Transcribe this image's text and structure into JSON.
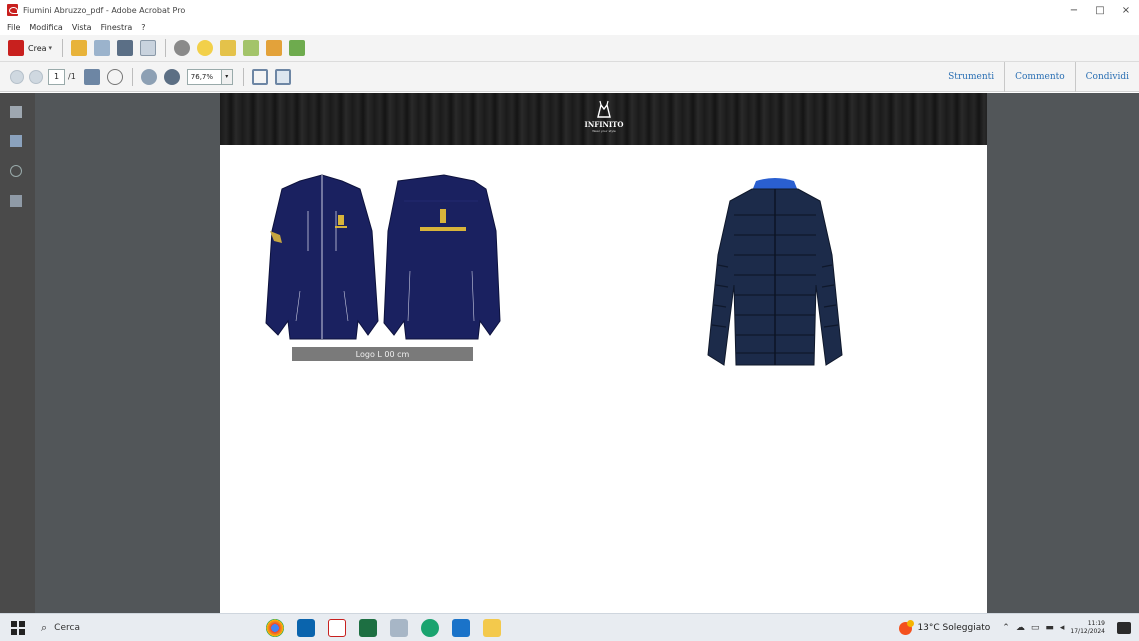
{
  "window": {
    "title": "Fiumini Abruzzo_pdf - Adobe Acrobat Pro",
    "minimize": "−",
    "maximize": "□",
    "close": "×"
  },
  "menu": [
    "File",
    "Modifica",
    "Vista",
    "Finestra",
    "?"
  ],
  "toolbar": {
    "crea_label": "Crea",
    "crea_arrow": "▾"
  },
  "navigation": {
    "current_page": "1",
    "total_pages": "/1",
    "zoom": "76,7%",
    "zoom_arrow": "▾"
  },
  "right_tabs": [
    "Strumenti",
    "Commento",
    "Condividi"
  ],
  "document": {
    "banner_brand": "INFINITO",
    "banner_sub": "Wear your style",
    "logo_caption": "Logo L 00 cm"
  },
  "taskbar": {
    "search_placeholder": "Cerca",
    "weather": "13°C Soleggiato",
    "time": "11:19",
    "date": "17/12/2024"
  },
  "colors": {
    "jacket_navy": "#1a2160",
    "puffer_navy": "#1c2b4a",
    "accent_blue": "#2a6fb3"
  }
}
